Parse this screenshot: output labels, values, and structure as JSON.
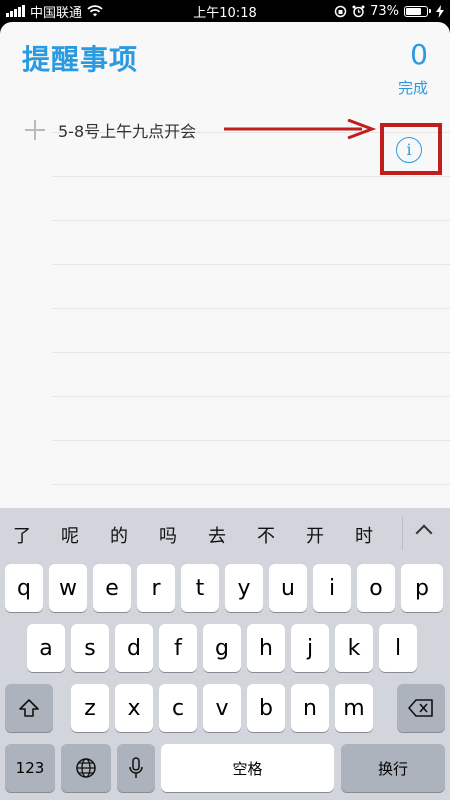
{
  "status_bar": {
    "carrier": "中国联通",
    "time": "上午10:18",
    "battery": "73%",
    "battery_level": 0.73
  },
  "app": {
    "title": "提醒事项",
    "count": "0",
    "done_label": "完成",
    "reminder_text": "5-8号上午九点开会",
    "info_glyph": "i",
    "annotation_color": "#c01d1d",
    "accent_color": "#2a9be0"
  },
  "keyboard": {
    "suggestions": [
      "了",
      "呢",
      "的",
      "吗",
      "去",
      "不",
      "开",
      "时"
    ],
    "row1": [
      "q",
      "w",
      "e",
      "r",
      "t",
      "y",
      "u",
      "i",
      "o",
      "p"
    ],
    "row2": [
      "a",
      "s",
      "d",
      "f",
      "g",
      "h",
      "j",
      "k",
      "l"
    ],
    "row3": [
      "z",
      "x",
      "c",
      "v",
      "b",
      "n",
      "m"
    ],
    "numbers_label": "123",
    "space_label": "空格",
    "return_label": "换行",
    "icons": {
      "shift": "shift-icon",
      "delete": "delete-icon",
      "globe": "globe-icon",
      "mic": "microphone-icon",
      "collapse": "chevron-up-icon"
    }
  }
}
